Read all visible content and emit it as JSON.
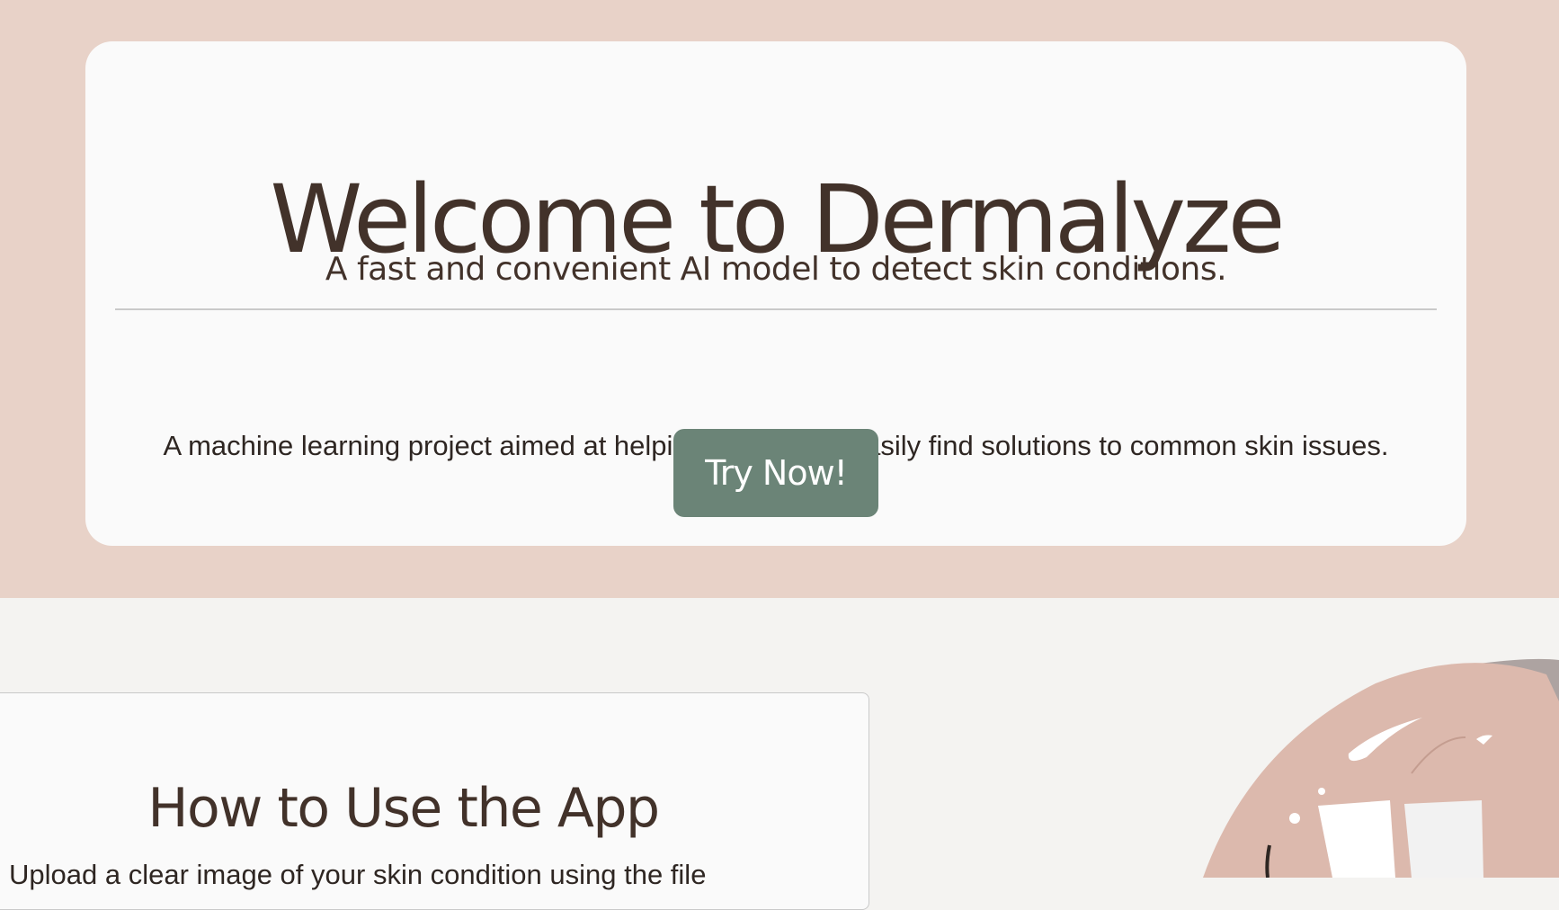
{
  "hero": {
    "title": "Welcome to Dermalyze",
    "subtitle": "A fast and convenient AI model to detect skin conditions.",
    "description": "A machine learning project aimed at helping individuals easily find solutions to common skin issues.",
    "cta_label": "Try Now!"
  },
  "how_to": {
    "title": "How to Use the App",
    "text": "Upload a clear image of your skin condition using the file"
  },
  "colors": {
    "hero_background": "#e8d2c8",
    "card_background": "#fafafa",
    "page_background": "#f4f3f1",
    "heading_text": "#42322a",
    "button_background": "#6b8477"
  },
  "icons": {
    "illustration": "skin-care-illustration-icon"
  }
}
